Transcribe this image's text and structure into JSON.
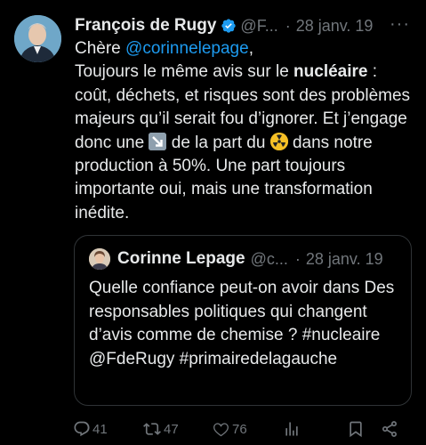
{
  "tweet": {
    "author_name": "François de Rugy",
    "author_handle": "@F...",
    "separator": "·",
    "date": "28 janv. 19",
    "more_label": "···",
    "text": {
      "greeting": "Chère ",
      "mention": "@corinnelepage",
      "greeting_end": ",",
      "p1": "Toujours le même avis sur le ",
      "bold": "nucléaire",
      "p2": " : coût, déchets, et risques sont des problèmes majeurs qu’il serait fou d’ignorer. Et j’engage donc une ",
      "p3": " de la part du ",
      "p4": " dans notre production à 50%. Une part toujours importante oui, mais une transformation inédite."
    },
    "icons": {
      "verified": "verified-badge-icon",
      "emoji1": "down-right-arrow-emoji",
      "emoji2": "radioactive-emoji"
    }
  },
  "quote": {
    "author_name": "Corinne Lepage",
    "author_handle": "@c...",
    "separator": "·",
    "date": "28 janv. 19",
    "text": "Quelle confiance peut-on avoir dans Des responsables politiques qui changent d’avis comme de chemise ? #nucleaire @FdeRugy #primairedelagauche"
  },
  "actions": {
    "replies": "41",
    "retweets": "47",
    "likes": "76",
    "views_icon": "views-chart-icon",
    "bookmark_icon": "bookmark-icon",
    "share_icon": "share-icon"
  },
  "colors": {
    "background": "#000000",
    "text": "#e7e9ea",
    "muted": "#71767b",
    "link": "#1d9bf0",
    "border": "#2f3336"
  }
}
